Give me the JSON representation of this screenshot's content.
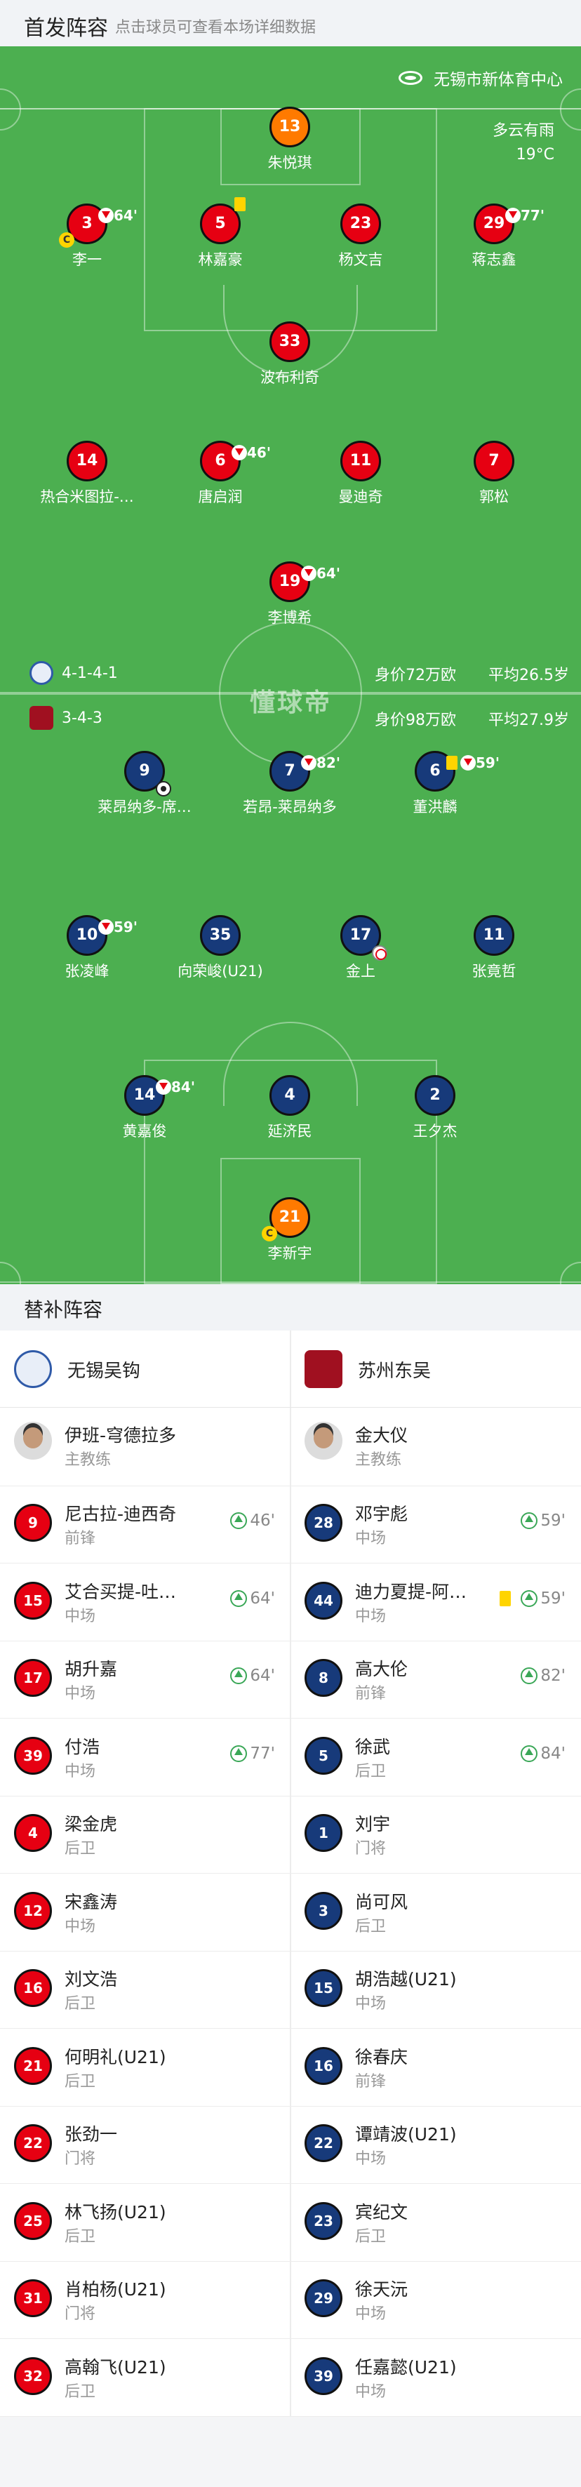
{
  "header": {
    "title": "首发阵容",
    "subtitle": "点击球员可查看本场详细数据"
  },
  "venue": {
    "icon": "stadium-icon",
    "name": "无锡市新体育中心"
  },
  "weather": {
    "condition": "多云有雨",
    "temperature": "19°C"
  },
  "home": {
    "formation": "4-1-4-1",
    "value": "身价72万欧",
    "age": "平均26.5岁",
    "players": [
      {
        "num": "13",
        "name": "朱悦琪"
      },
      {
        "num": "3",
        "name": "李一",
        "sub": "64'"
      },
      {
        "num": "5",
        "name": "林嘉豪"
      },
      {
        "num": "23",
        "name": "杨文吉"
      },
      {
        "num": "29",
        "name": "蒋志鑫",
        "sub": "77'"
      },
      {
        "num": "33",
        "name": "波布利奇"
      },
      {
        "num": "14",
        "name": "热合米图拉-…"
      },
      {
        "num": "6",
        "name": "唐启润",
        "sub": "46'"
      },
      {
        "num": "11",
        "name": "曼迪奇"
      },
      {
        "num": "7",
        "name": "郭松"
      },
      {
        "num": "19",
        "name": "李博希",
        "sub": "64'"
      }
    ]
  },
  "away": {
    "formation": "3-4-3",
    "value": "身价98万欧",
    "age": "平均27.9岁",
    "players": [
      {
        "num": "9",
        "name": "莱昂纳多-席…"
      },
      {
        "num": "7",
        "name": "若昂-莱昂纳多",
        "sub": "82'"
      },
      {
        "num": "6",
        "name": "董洪麟",
        "sub": "59'"
      },
      {
        "num": "10",
        "name": "张凌峰",
        "sub": "59'"
      },
      {
        "num": "35",
        "name": "向荣峻(U21)"
      },
      {
        "num": "17",
        "name": "金上"
      },
      {
        "num": "11",
        "name": "张竟哲"
      },
      {
        "num": "14",
        "name": "黄嘉俊",
        "sub": "84'"
      },
      {
        "num": "4",
        "name": "延济民"
      },
      {
        "num": "2",
        "name": "王夕杰"
      },
      {
        "num": "21",
        "name": "李新宇"
      }
    ]
  },
  "watermark": "懂球帝",
  "captain_mark": "C",
  "subs_section": {
    "title": "替补阵容"
  },
  "teams": {
    "home": "无锡吴钩",
    "away": "苏州东吴"
  },
  "coaches": {
    "home": {
      "name": "伊班-穹德拉多",
      "role": "主教练"
    },
    "away": {
      "name": "金大仪",
      "role": "主教练"
    }
  },
  "bench": {
    "home": [
      {
        "num": "9",
        "name": "尼古拉-迪西奇",
        "pos": "前锋",
        "min": "46'"
      },
      {
        "num": "15",
        "name": "艾合买提-吐…",
        "pos": "中场",
        "min": "64'"
      },
      {
        "num": "17",
        "name": "胡升嘉",
        "pos": "中场",
        "min": "64'"
      },
      {
        "num": "39",
        "name": "付浩",
        "pos": "中场",
        "min": "77'"
      },
      {
        "num": "4",
        "name": "梁金虎",
        "pos": "后卫"
      },
      {
        "num": "12",
        "name": "宋鑫涛",
        "pos": "中场"
      },
      {
        "num": "16",
        "name": "刘文浩",
        "pos": "后卫"
      },
      {
        "num": "21",
        "name": "何明礼(U21)",
        "pos": "后卫"
      },
      {
        "num": "22",
        "name": "张劲一",
        "pos": "门将"
      },
      {
        "num": "25",
        "name": "林飞扬(U21)",
        "pos": "后卫"
      },
      {
        "num": "31",
        "name": "肖柏杨(U21)",
        "pos": "门将"
      },
      {
        "num": "32",
        "name": "高翰飞(U21)",
        "pos": "后卫"
      }
    ],
    "away": [
      {
        "num": "28",
        "name": "邓宇彪",
        "pos": "中场",
        "min": "59'"
      },
      {
        "num": "44",
        "name": "迪力夏提-阿…",
        "pos": "中场",
        "min": "59'"
      },
      {
        "num": "8",
        "name": "高大伦",
        "pos": "前锋",
        "min": "82'"
      },
      {
        "num": "5",
        "name": "徐武",
        "pos": "后卫",
        "min": "84'"
      },
      {
        "num": "1",
        "name": "刘宇",
        "pos": "门将"
      },
      {
        "num": "3",
        "name": "尚可风",
        "pos": "后卫"
      },
      {
        "num": "15",
        "name": "胡浩越(U21)",
        "pos": "中场"
      },
      {
        "num": "16",
        "name": "徐春庆",
        "pos": "前锋"
      },
      {
        "num": "22",
        "name": "谭靖波(U21)",
        "pos": "中场"
      },
      {
        "num": "23",
        "name": "宾纪文",
        "pos": "后卫"
      },
      {
        "num": "29",
        "name": "徐天沅",
        "pos": "中场"
      },
      {
        "num": "39",
        "name": "任嘉懿(U21)",
        "pos": "中场"
      }
    ]
  },
  "colors": {
    "pitch": "#4caf50",
    "home_kit": "#e60012",
    "away_kit": "#173a7a",
    "goalkeeper": "#ff7a00",
    "sub_in": "#3aa757",
    "yellow_card": "#ffd400"
  }
}
